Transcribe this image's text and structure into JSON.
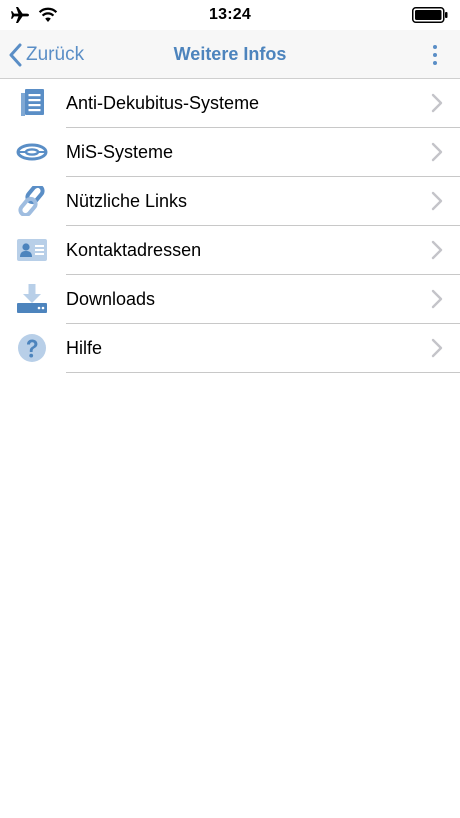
{
  "status": {
    "time": "13:24"
  },
  "nav": {
    "back_label": "Zurück",
    "title": "Weitere Infos"
  },
  "colors": {
    "accent": "#4d84bd",
    "icon_blue": "#5a8ec6",
    "icon_light": "#b8cfe8"
  },
  "menu": [
    {
      "label": "Anti-Dekubitus-Systeme",
      "icon": "document-list-icon"
    },
    {
      "label": "MiS-Systeme",
      "icon": "mis-ring-icon"
    },
    {
      "label": "Nützliche Links",
      "icon": "link-icon"
    },
    {
      "label": "Kontaktadressen",
      "icon": "contact-card-icon"
    },
    {
      "label": "Downloads",
      "icon": "download-icon"
    },
    {
      "label": "Hilfe",
      "icon": "help-icon"
    }
  ]
}
